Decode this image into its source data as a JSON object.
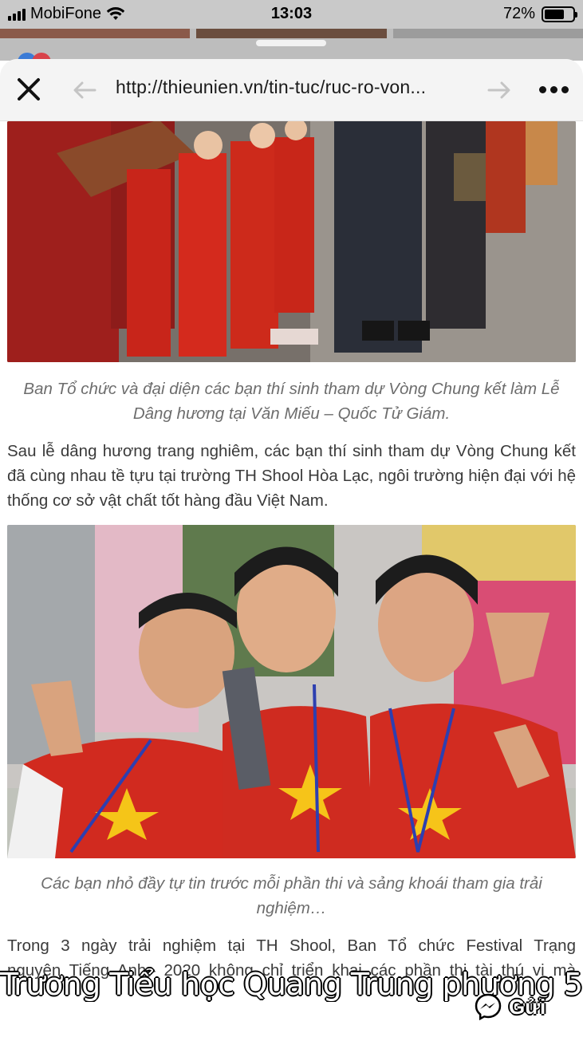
{
  "status_bar": {
    "carrier": "MobiFone",
    "time": "13:03",
    "battery_percent": "72%",
    "battery_level": 0.72
  },
  "browser": {
    "url": "http://thieunien.vn/tin-tuc/ruc-ro-von...",
    "icons": {
      "close": "close-icon",
      "back": "back-arrow-icon",
      "forward": "forward-arrow-icon",
      "more": "more-icon"
    }
  },
  "article": {
    "image1_alt": "",
    "caption1": "Ban Tổ chức và đại diện các bạn thí sinh tham dự Vòng Chung kết làm Lễ Dâng hương tại Văn Miếu – Quốc Tử Giám.",
    "paragraph1": "Sau lễ dâng hương trang nghiêm, các bạn thí sinh tham dự Vòng Chung kết đã cùng nhau tề tựu tại trường TH Shool Hòa Lạc, ngôi trường hiện đại với hệ thống cơ sở vật chất tốt hàng đầu Việt Nam.",
    "caption2": "Các bạn nhỏ đầy tự tin trước mỗi phần thi và sảng khoái tham gia trải nghiệm…",
    "paragraph2_line1": "Trong 3 ngày trải nghiệm tại TH Shool, Ban Tổ chức Festival Trạng",
    "paragraph2_line2": "nguyên Tiếng Anh– 2020 không chỉ triển khai các phần thi tài thú vị mà"
  },
  "overlay": {
    "chat_text": "Trương Tiểu học Quang Trung phương 5",
    "send_label": "Gửi",
    "send_icon": "messenger-icon"
  },
  "colors": {
    "status_bg": "#c9c9c9",
    "urlbar_bg": "#f4f4f4",
    "caption": "#6d6d6d",
    "body_text": "#3a3a3a"
  }
}
